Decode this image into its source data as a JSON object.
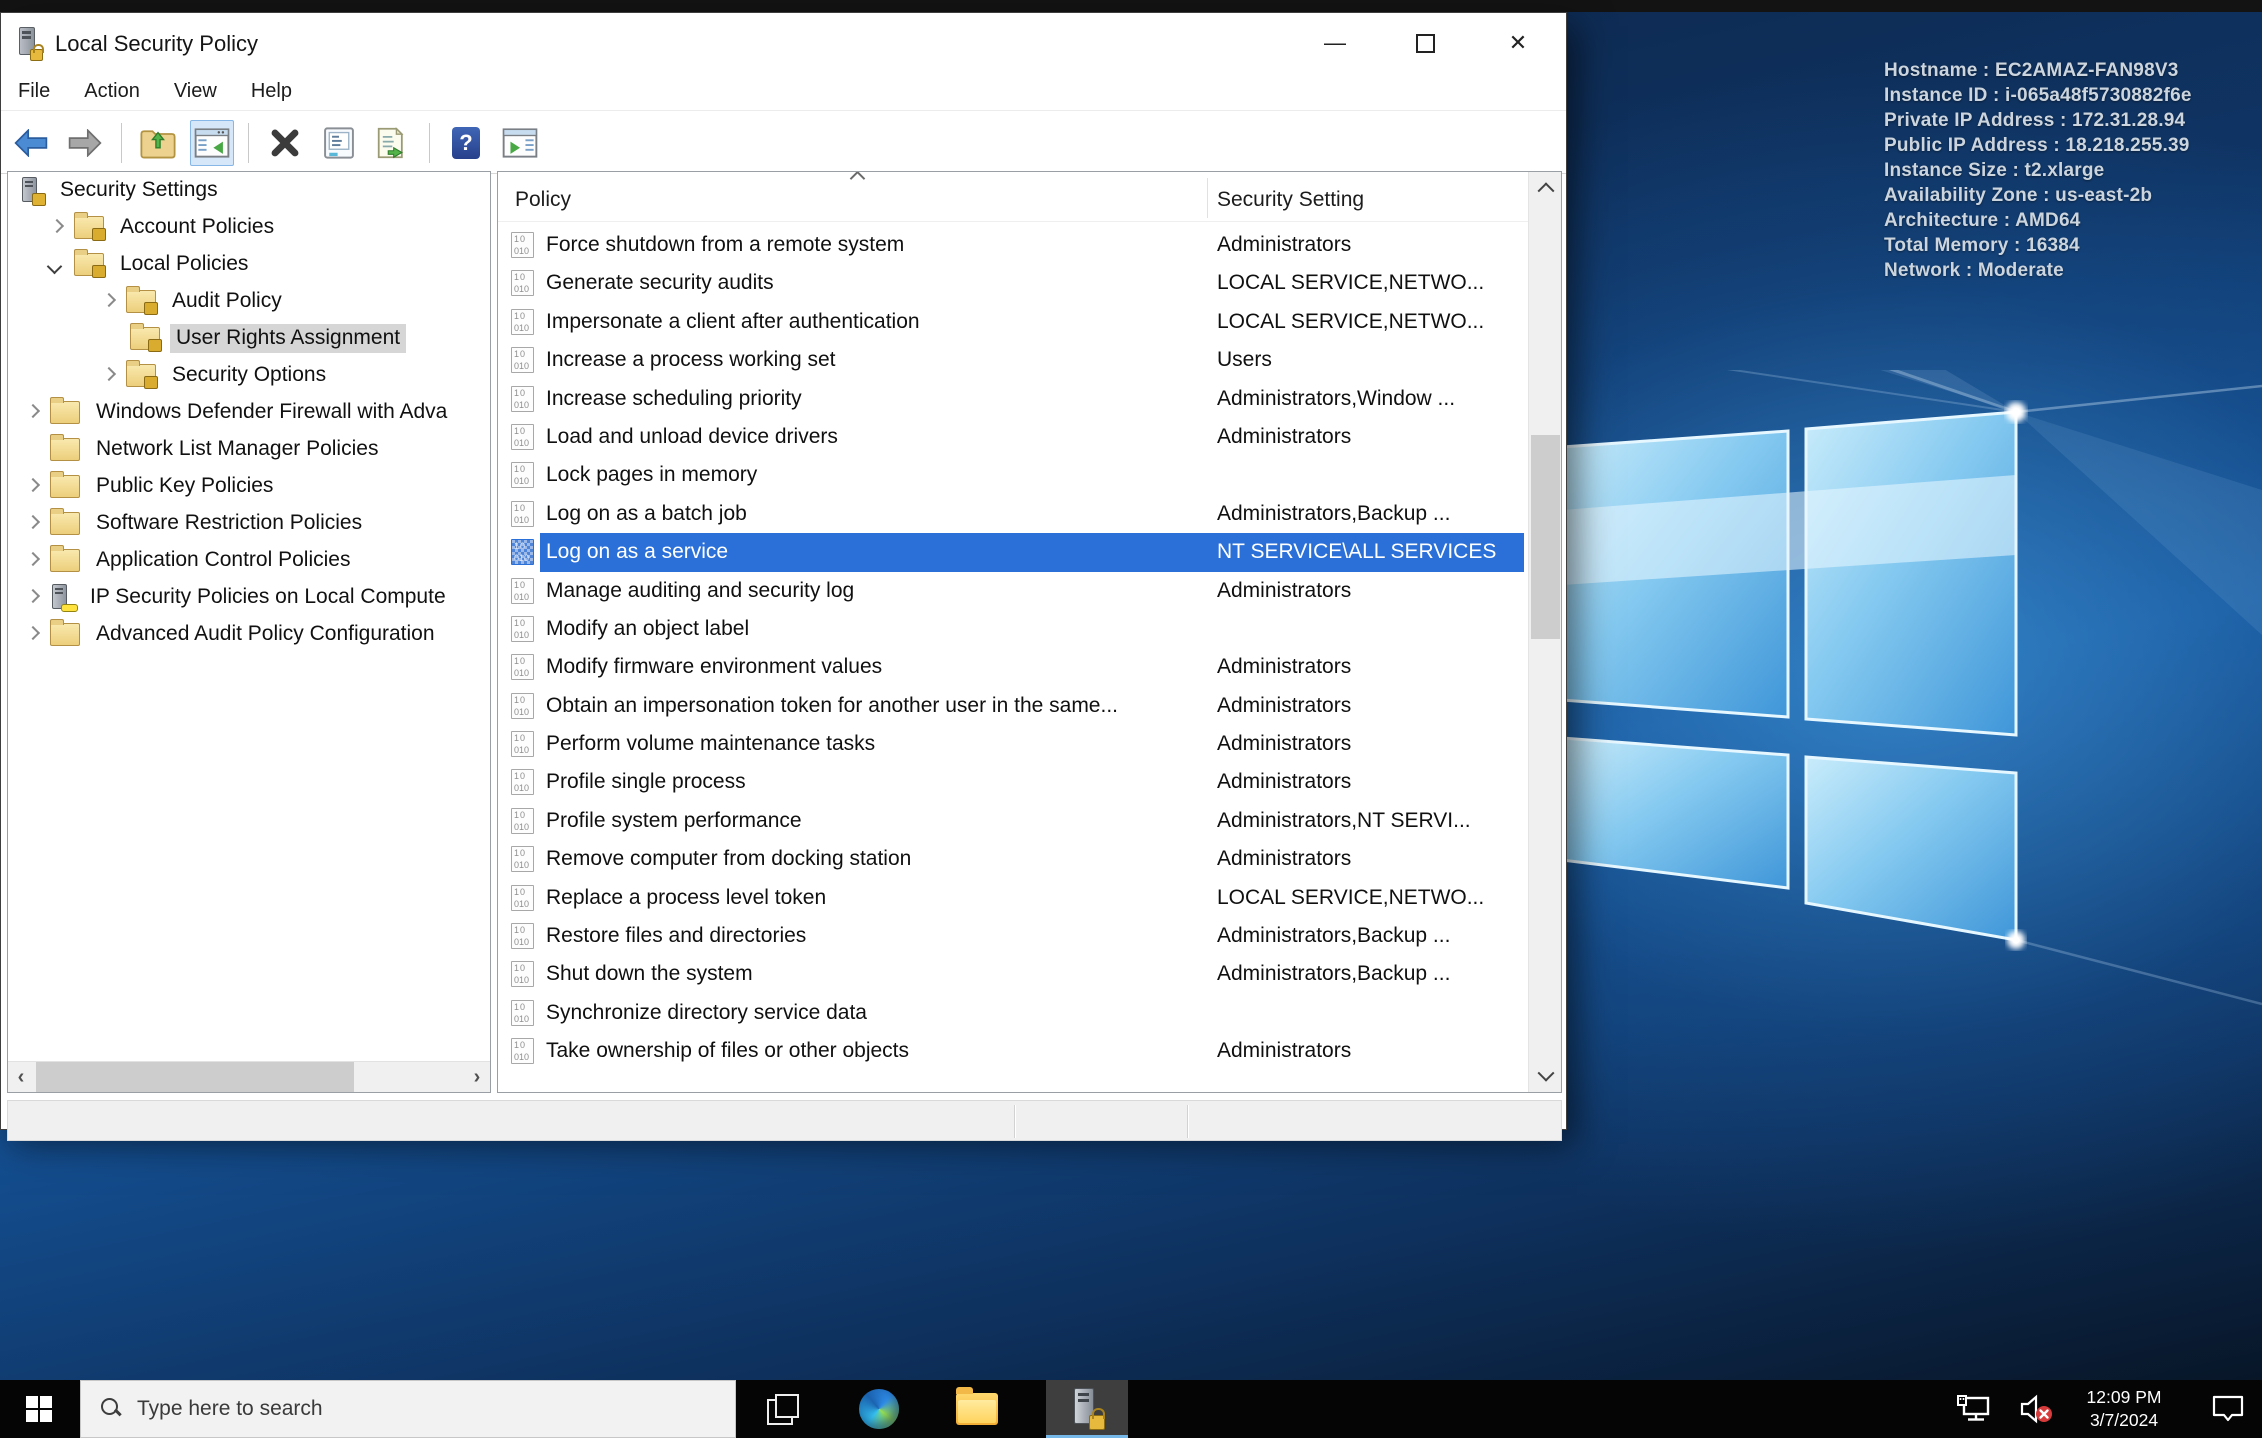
{
  "window": {
    "title": "Local Security Policy",
    "controls": {
      "minimize": "—",
      "close": "✕"
    },
    "menu": {
      "file": "File",
      "action": "Action",
      "view": "View",
      "help": "Help"
    },
    "toolbar": {
      "help_glyph": "?"
    },
    "tree": {
      "items": [
        {
          "label": "Security Settings"
        },
        {
          "label": "Account Policies"
        },
        {
          "label": "Local Policies"
        },
        {
          "label": "Audit Policy"
        },
        {
          "label": "User Rights Assignment"
        },
        {
          "label": "Security Options"
        },
        {
          "label": "Windows Defender Firewall with Adva"
        },
        {
          "label": "Network List Manager Policies"
        },
        {
          "label": "Public Key Policies"
        },
        {
          "label": "Software Restriction Policies"
        },
        {
          "label": "Application Control Policies"
        },
        {
          "label": "IP Security Policies on Local Compute"
        },
        {
          "label": "Advanced Audit Policy Configuration"
        }
      ]
    },
    "list": {
      "columns": {
        "policy": "Policy",
        "setting": "Security Setting"
      },
      "rows": [
        {
          "policy": "Force shutdown from a remote system",
          "setting": "Administrators"
        },
        {
          "policy": "Generate security audits",
          "setting": "LOCAL SERVICE,NETWO..."
        },
        {
          "policy": "Impersonate a client after authentication",
          "setting": "LOCAL SERVICE,NETWO..."
        },
        {
          "policy": "Increase a process working set",
          "setting": "Users"
        },
        {
          "policy": "Increase scheduling priority",
          "setting": "Administrators,Window ..."
        },
        {
          "policy": "Load and unload device drivers",
          "setting": "Administrators"
        },
        {
          "policy": "Lock pages in memory",
          "setting": ""
        },
        {
          "policy": "Log on as a batch job",
          "setting": "Administrators,Backup ..."
        },
        {
          "policy": "Log on as a service",
          "setting": "NT SERVICE\\ALL SERVICES"
        },
        {
          "policy": "Manage auditing and security log",
          "setting": "Administrators"
        },
        {
          "policy": "Modify an object label",
          "setting": ""
        },
        {
          "policy": "Modify firmware environment values",
          "setting": "Administrators"
        },
        {
          "policy": "Obtain an impersonation token for another user in the same...",
          "setting": "Administrators"
        },
        {
          "policy": "Perform volume maintenance tasks",
          "setting": "Administrators"
        },
        {
          "policy": "Profile single process",
          "setting": "Administrators"
        },
        {
          "policy": "Profile system performance",
          "setting": "Administrators,NT SERVI..."
        },
        {
          "policy": "Remove computer from docking station",
          "setting": "Administrators"
        },
        {
          "policy": "Replace a process level token",
          "setting": "LOCAL SERVICE,NETWO..."
        },
        {
          "policy": "Restore files and directories",
          "setting": "Administrators,Backup ..."
        },
        {
          "policy": "Shut down the system",
          "setting": "Administrators,Backup ..."
        },
        {
          "policy": "Synchronize directory service data",
          "setting": ""
        },
        {
          "policy": "Take ownership of files or other objects",
          "setting": "Administrators"
        }
      ],
      "selected_row": "Log on as a service"
    }
  },
  "desktop": {
    "host_info": {
      "line1": "Hostname : EC2AMAZ-FAN98V3",
      "line2": "Instance ID : i-065a48f5730882f6e",
      "line3": "Private IP Address : 172.31.28.94",
      "line4": "Public IP Address : 18.218.255.39",
      "line5": "Instance Size : t2.xlarge",
      "line6": "Availability Zone : us-east-2b",
      "line7": "Architecture : AMD64",
      "line8": "Total Memory : 16384",
      "line9": "Network : Moderate"
    }
  },
  "taskbar": {
    "search_placeholder": "Type here to search",
    "clock_time": "12:09 PM",
    "clock_date": "3/7/2024"
  },
  "colors": {
    "selection_blue": "#2a70d8",
    "taskbar_black": "#050505",
    "active_app_underline": "#76b9e8",
    "wallpaper_navy": "#0c2140"
  }
}
